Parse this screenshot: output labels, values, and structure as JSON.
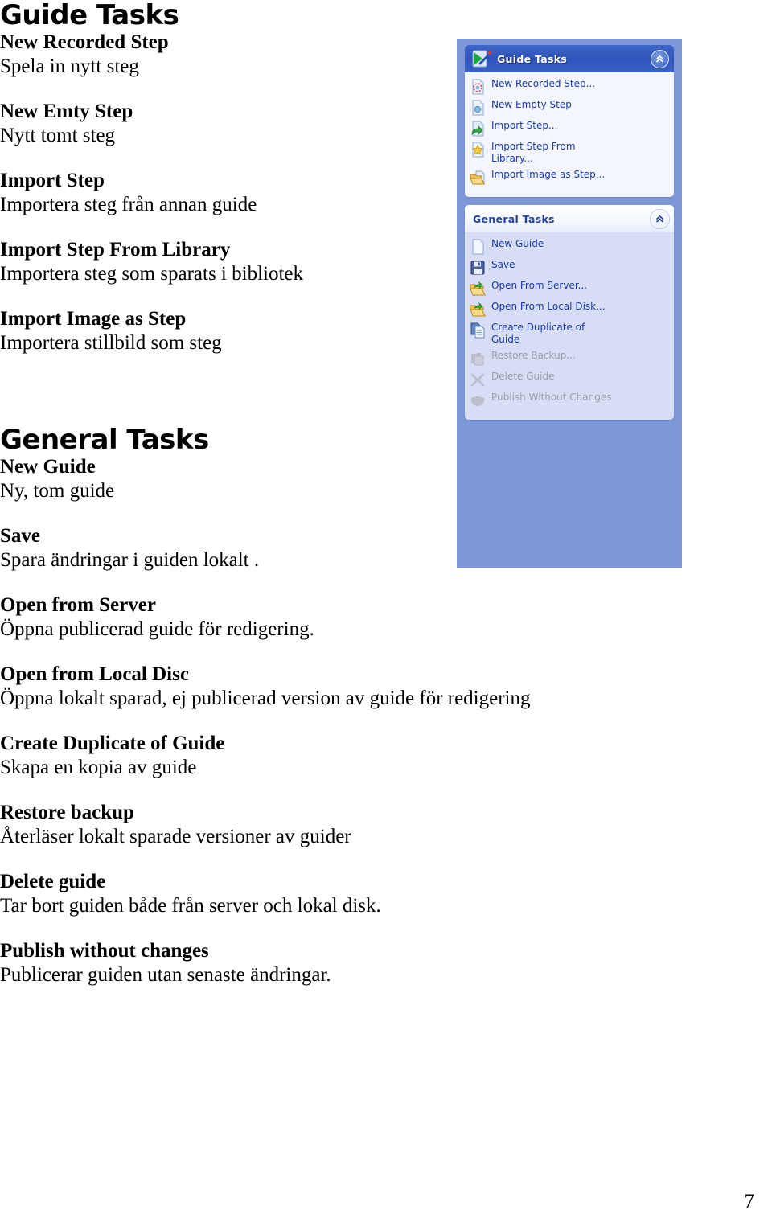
{
  "document": {
    "page_number": "7",
    "sections": [
      {
        "heading": "Guide Tasks",
        "entries": [
          {
            "term": "New Recorded Step",
            "desc": "Spela in nytt steg"
          },
          {
            "term": "New Emty Step",
            "desc": "Nytt tomt steg"
          },
          {
            "term": "Import Step",
            "desc": "Importera steg från annan guide"
          },
          {
            "term": "Import Step From Library",
            "desc": "Importera steg som sparats i bibliotek"
          },
          {
            "term": "Import Image as Step",
            "desc": "Importera stillbild som steg"
          }
        ]
      },
      {
        "heading": "General Tasks",
        "entries": [
          {
            "term": "New Guide",
            "desc": "Ny, tom guide"
          },
          {
            "term": "Save",
            "desc": "Spara ändringar i guiden lokalt ."
          },
          {
            "term": "Open from Server",
            "desc": "Öppna publicerad guide för redigering."
          },
          {
            "term": "Open from Local Disc",
            "desc": "Öppna lokalt sparad, ej publicerad version av guide för redigering"
          },
          {
            "term": "Create Duplicate of Guide",
            "desc": "Skapa en kopia av guide"
          },
          {
            "term": "Restore backup",
            "desc": "Återläser lokalt sparade versioner av guider"
          },
          {
            "term": "Delete guide",
            "desc": "Tar bort guiden både från server och lokal disk."
          },
          {
            "term": "Publish without changes",
            "desc": "Publicerar guiden utan senaste ändringar."
          }
        ]
      }
    ]
  },
  "screenshot": {
    "background_color": "#7d98d8",
    "accent_color": "#1a3ca8",
    "panels": [
      {
        "title": "Guide Tasks",
        "header_style": "blue",
        "collapse_glyph": "«",
        "items": [
          {
            "label": "New Recorded Step...",
            "icon": "recorded-step-icon",
            "enabled": true
          },
          {
            "label": "New Empty Step",
            "icon": "empty-step-icon",
            "enabled": true
          },
          {
            "label": "Import Step...",
            "icon": "import-step-icon",
            "enabled": true
          },
          {
            "label": "Import Step From Library...",
            "icon": "library-star-icon",
            "enabled": true
          },
          {
            "label": "Import Image as Step...",
            "icon": "open-folder-icon",
            "enabled": true
          }
        ]
      },
      {
        "title": "General Tasks",
        "header_style": "white",
        "collapse_glyph": "«",
        "items": [
          {
            "label": "New Guide",
            "accel": "N",
            "icon": "new-document-icon",
            "enabled": true
          },
          {
            "label": "Save",
            "accel": "S",
            "icon": "floppy-save-icon",
            "enabled": true
          },
          {
            "label": "Open From Server...",
            "icon": "open-folder-arrow-icon",
            "enabled": true
          },
          {
            "label": "Open From Local Disk...",
            "icon": "open-folder-arrow-icon",
            "enabled": true
          },
          {
            "label": "Create Duplicate of Guide",
            "icon": "duplicate-icon",
            "enabled": true
          },
          {
            "label": "Restore Backup...",
            "icon": "restore-backup-icon",
            "enabled": false
          },
          {
            "label": "Delete Guide",
            "icon": "delete-x-icon",
            "enabled": false
          },
          {
            "label": "Publish Without Changes",
            "icon": "publish-cloud-icon",
            "enabled": false
          }
        ]
      }
    ]
  }
}
